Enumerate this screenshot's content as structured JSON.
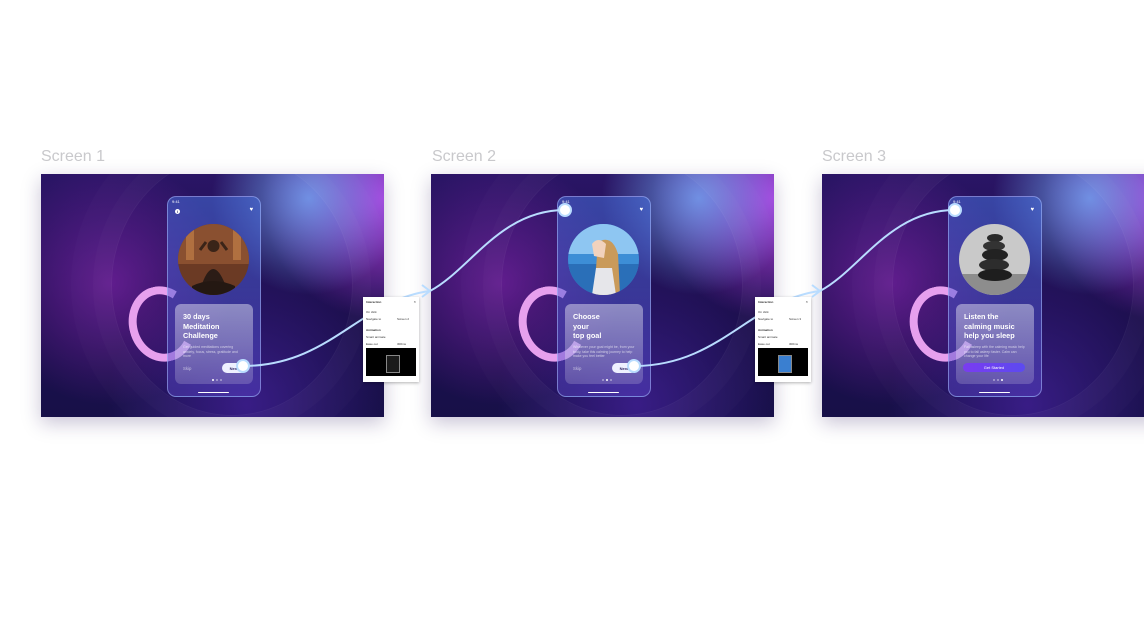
{
  "frames": [
    {
      "label": "Screen 1",
      "status_time": "9:41",
      "title": "30 days\nMeditation\nChallenge",
      "description": "Get guided meditations covering anxiety, focus, stress, gratitude and more",
      "skip_label": "Skip",
      "next_label": "Next",
      "active_dot": 0
    },
    {
      "label": "Screen 2",
      "status_time": "9:41",
      "title": "Choose\nyour\ntop goal",
      "description": "Whatever your goal might be, from your body, take this calming journey to help make you feel better",
      "skip_label": "Skip",
      "next_label": "Next",
      "active_dot": 1
    },
    {
      "label": "Screen 3",
      "status_time": "9:41",
      "title": "Listen the\ncalming music\nhelp you sleep",
      "description": "Fall asleep with the calming music help you to fall asleep faster. Calm can change your life",
      "cta_label": "Get Started",
      "active_dot": 2
    }
  ],
  "prototype_panels": [
    {
      "title": "Interaction",
      "trigger": "On click",
      "action": "Navigate to",
      "destination": "Screen 2",
      "animation_heading": "Animation",
      "animation": "Smart animate",
      "easing": "Ease out",
      "duration": "300ms"
    },
    {
      "title": "Interaction",
      "trigger": "On click",
      "action": "Navigate to",
      "destination": "Screen 3",
      "animation_heading": "Animation",
      "animation": "Smart animate",
      "easing": "Ease out",
      "duration": "300ms"
    }
  ],
  "colors": {
    "connector": "#b9dcff",
    "accent": "#7a3cf0",
    "swirl": "#e7a0ee"
  },
  "icons": [
    "info-icon",
    "heart-icon",
    "close-icon",
    "phone-thumbnail-icon"
  ]
}
